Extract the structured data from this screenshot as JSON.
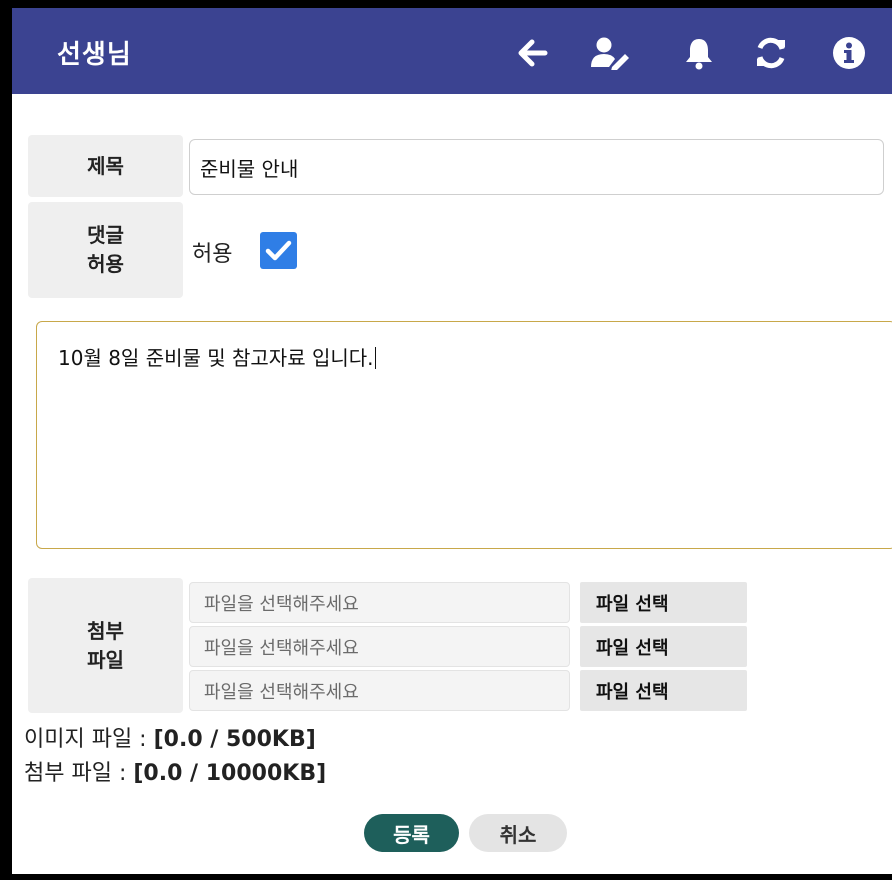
{
  "header": {
    "title": "선생님",
    "icons": [
      "back-arrow-icon",
      "user-edit-icon",
      "bell-icon",
      "refresh-icon",
      "info-icon"
    ]
  },
  "form": {
    "title_label": "제목",
    "title_value": "준비물 안내",
    "comment_label_line1": "댓글",
    "comment_label_line2": "허용",
    "allow_text": "허용",
    "allow_checked": true,
    "content": "10월 8일 준비물 및 참고자료 입니다.",
    "attach_label_line1": "첨부",
    "attach_label_line2": "파일",
    "attachments": [
      {
        "placeholder": "파일을 선택해주세요",
        "button": "파일 선택"
      },
      {
        "placeholder": "파일을 선택해주세요",
        "button": "파일 선택"
      },
      {
        "placeholder": "파일을 선택해주세요",
        "button": "파일 선택"
      }
    ],
    "image_size_label": "이미지 파일 : ",
    "image_size_value": "[0.0 / 500KB]",
    "attach_size_label": "첨부 파일 : ",
    "attach_size_value": "[0.0 / 10000KB]"
  },
  "actions": {
    "submit": "등록",
    "cancel": "취소"
  },
  "colors": {
    "header_bg": "#3b4391",
    "checkbox": "#2f7ee6",
    "submit_bg": "#1e5f5b",
    "content_border": "#c8a84a"
  }
}
